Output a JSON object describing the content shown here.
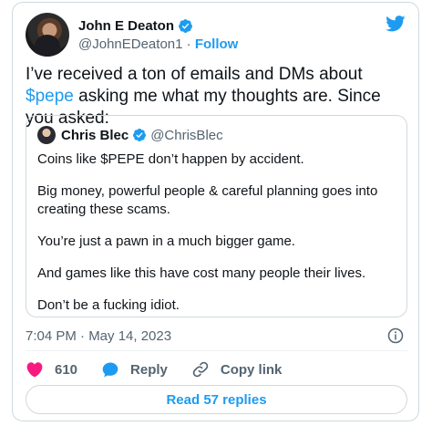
{
  "author": {
    "name": "John E Deaton",
    "handle": "@JohnEDeaton1",
    "separator": "·",
    "follow_label": "Follow"
  },
  "tweet": {
    "text_before": "I’ve received a ton of emails and DMs about ",
    "cashtag": "$pepe",
    "text_after": " asking me what my thoughts are. Since you asked:"
  },
  "quote": {
    "name": "Chris Blec",
    "handle": "@ChrisBlec",
    "paragraphs": [
      "Coins like $PEPE don’t happen by accident.",
      "Big money, powerful people & careful planning goes into creating these scams.",
      "You’re just a pawn in a much bigger game.",
      "And games like this have cost many people their lives.",
      "Don’t be a fucking idiot."
    ]
  },
  "meta": {
    "timestamp": "7:04 PM · May 14, 2023"
  },
  "actions": {
    "like_count": "610",
    "reply_label": "Reply",
    "copy_label": "Copy link"
  },
  "footer": {
    "read_replies_label": "Read 57 replies"
  },
  "icons": {
    "verified": "verified-badge-icon",
    "bird": "twitter-bird-icon",
    "info": "info-icon",
    "like": "heart-icon",
    "reply": "speech-bubble-icon",
    "copy": "link-icon"
  },
  "colors": {
    "accent": "#1d9bf0",
    "like": "#f91880",
    "text": "#0f1419",
    "muted": "#536471",
    "border": "#cfd9de"
  }
}
